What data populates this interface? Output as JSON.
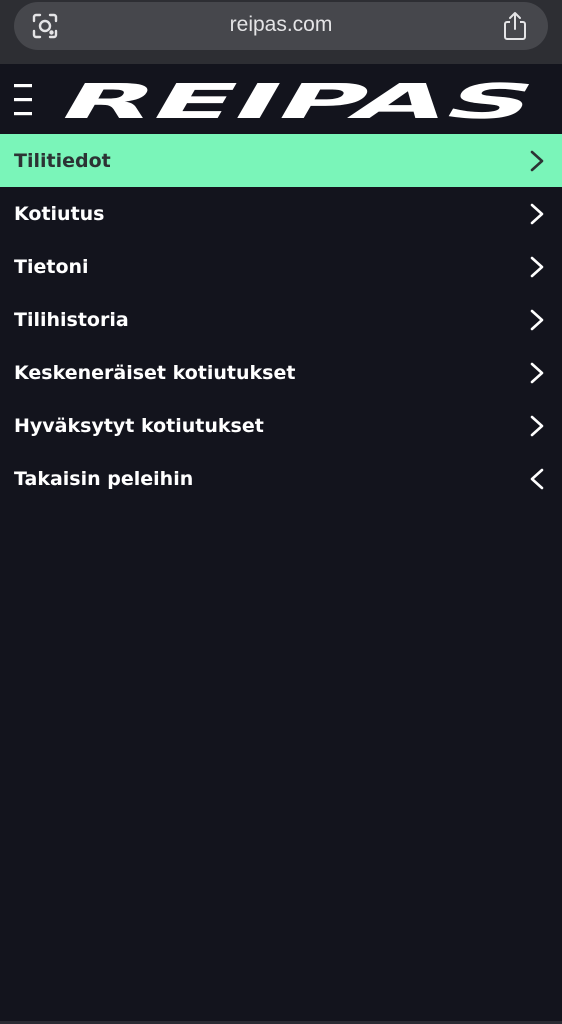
{
  "browser": {
    "url": "reipas.com"
  },
  "header": {
    "logo_text": "REIPAS"
  },
  "menu": {
    "items": [
      {
        "label": "Tilitiedot",
        "chevron": "chevron-right-icon",
        "active": true
      },
      {
        "label": "Kotiutus",
        "chevron": "chevron-right-icon"
      },
      {
        "label": "Tietoni",
        "chevron": "chevron-right-icon"
      },
      {
        "label": "Tilihistoria",
        "chevron": "chevron-right-icon"
      },
      {
        "label": "Keskeneräiset kotiutukset",
        "chevron": "chevron-right-icon"
      },
      {
        "label": "Hyväksytyt kotiutukset",
        "chevron": "chevron-right-icon"
      },
      {
        "label": "Takaisin peleihin",
        "chevron": "chevron-left-icon"
      }
    ]
  },
  "colors": {
    "background": "#13141d",
    "accent": "#7af5b9",
    "active_text": "#2c3334",
    "text": "#ffffff",
    "browser_bar": "#2d2e33"
  }
}
